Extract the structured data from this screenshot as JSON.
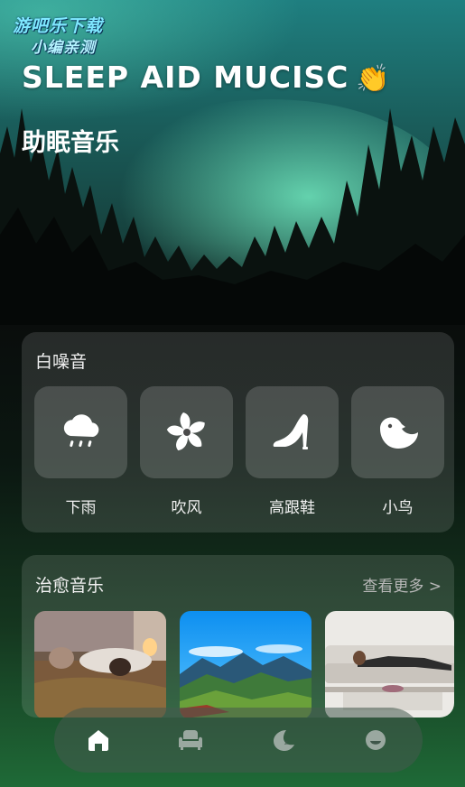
{
  "watermark": {
    "line1": "游吧乐下载",
    "line2": "小编亲测"
  },
  "header": {
    "title": "SLEEP AID MUCISC",
    "title_emoji": "👏",
    "subtitle": "助眠音乐"
  },
  "white_noise": {
    "title": "白噪音",
    "items": [
      {
        "label": "下雨",
        "icon": "rain-cloud-icon"
      },
      {
        "label": "吹风",
        "icon": "fan-icon"
      },
      {
        "label": "高跟鞋",
        "icon": "high-heel-icon"
      },
      {
        "label": "小鸟",
        "icon": "bird-icon"
      }
    ]
  },
  "healing_music": {
    "title": "治愈音乐",
    "more": "查看更多 >",
    "items": [
      {
        "image": "child-sleeping-bed-photo"
      },
      {
        "image": "mountain-landscape-photo"
      },
      {
        "image": "woman-lying-sofa-photo"
      }
    ]
  },
  "tabs": [
    {
      "icon": "home-icon",
      "active": true
    },
    {
      "icon": "sofa-icon",
      "active": false
    },
    {
      "icon": "moon-icon",
      "active": false
    },
    {
      "icon": "face-icon",
      "active": false
    }
  ],
  "colors": {
    "accent": "#ffffff",
    "aurora": "#46c9a0",
    "inactive_tab": "#9aa8a0"
  }
}
